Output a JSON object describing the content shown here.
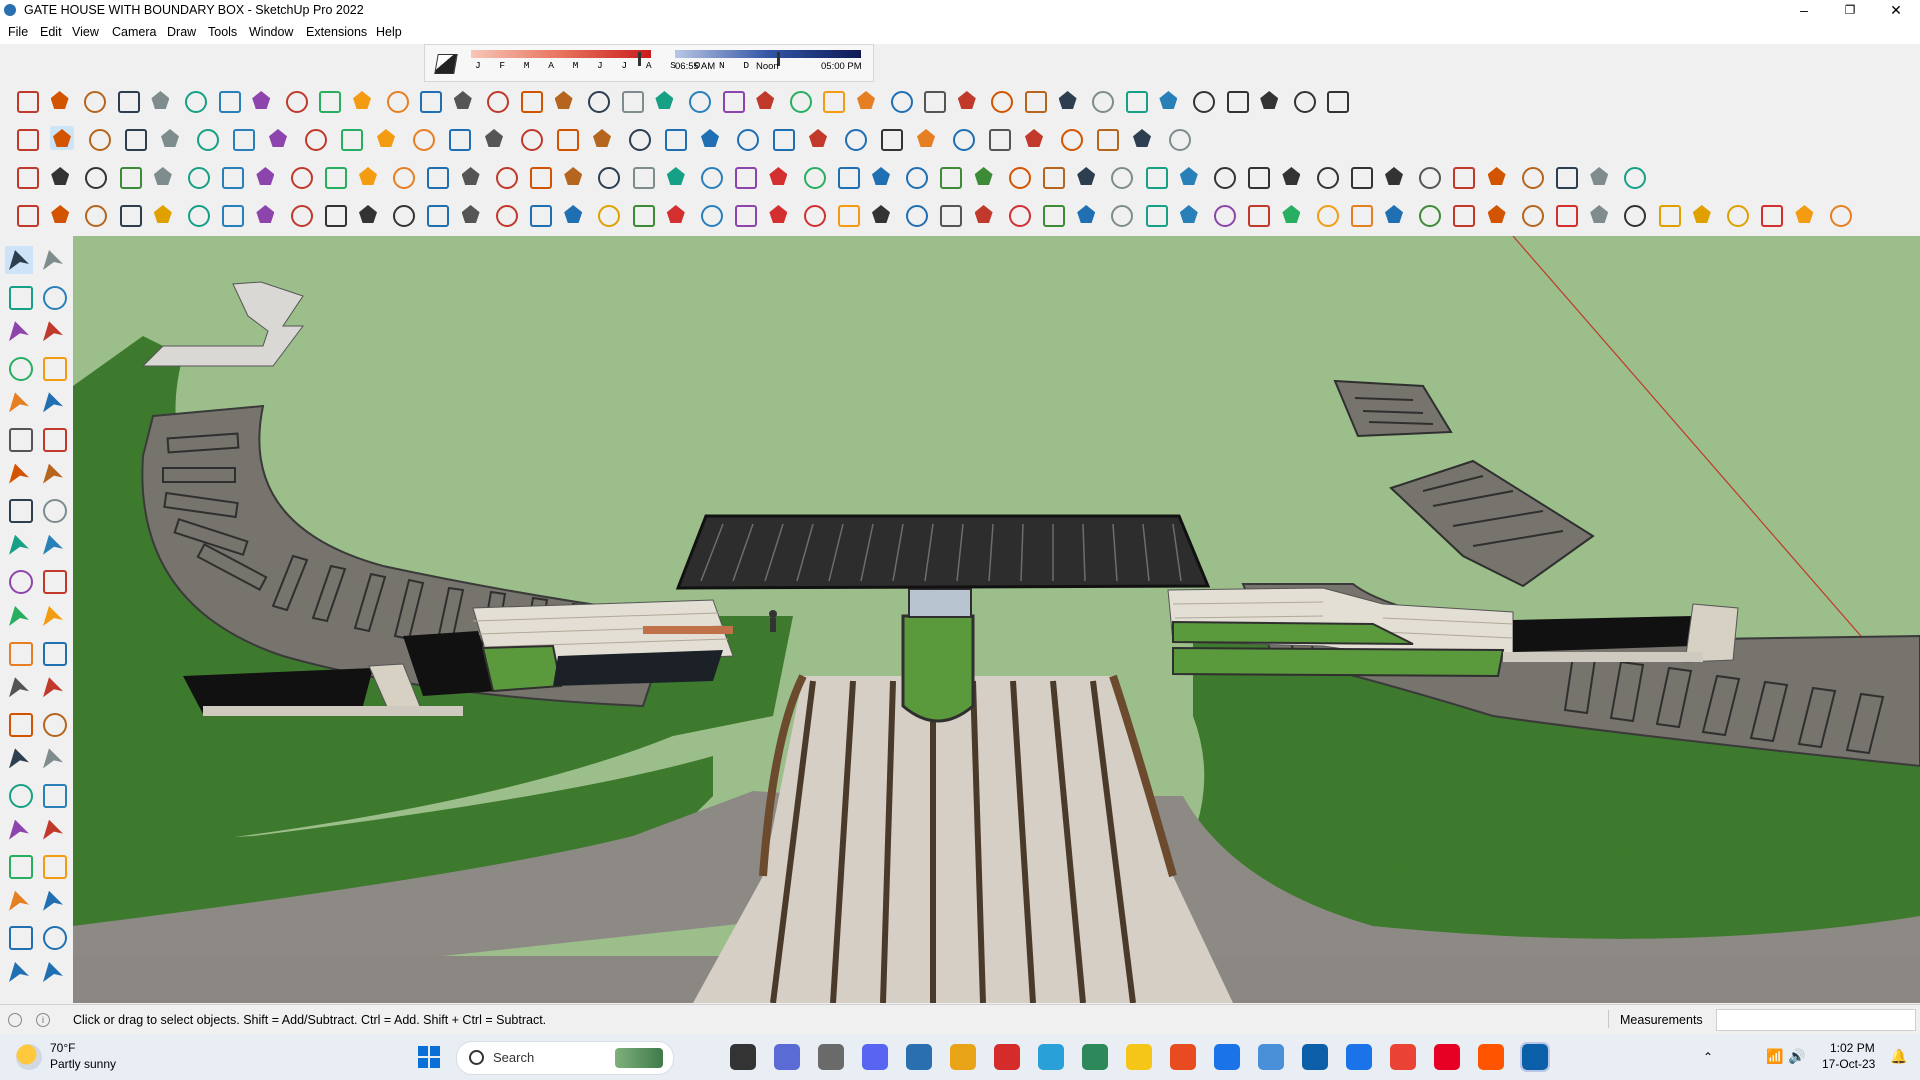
{
  "window": {
    "title": "GATE HOUSE WITH BOUNDARY BOX - SketchUp Pro 2022",
    "controls": {
      "minimize": "–",
      "maximize": "❐",
      "close": "✕"
    }
  },
  "menu": [
    "File",
    "Edit",
    "View",
    "Camera",
    "Draw",
    "Tools",
    "Window",
    "Extensions",
    "Help"
  ],
  "shadows": {
    "months": "J F M A M J J A S O N D",
    "time_start": "06:55 AM",
    "time_mid": "Noon",
    "time_end": "05:00 PM",
    "month_position": 0.93,
    "time_position": 0.55
  },
  "toolbars": {
    "row1": [
      "freehand-icon",
      "arc-curve-icon",
      "eraser-line-icon",
      "cut-icon",
      "rotate-icon",
      "move-icon",
      "follow-me-icon",
      "path-icon",
      "sphere-icon",
      "sweep-icon",
      "line-icon",
      "bevel-icon",
      "line-icon",
      "arc-icon",
      "frame-icon",
      "plane-icon",
      "stair-icon",
      "stair-icon",
      "grid-icon",
      "arc-icon",
      "window-icon",
      "door-icon",
      "roof-icon",
      "roof-icon",
      "wall-icon",
      "column-icon",
      "column-icon",
      "fence-icon",
      "facade-icon",
      "facade-icon",
      "pattern-icon",
      "pattern-icon",
      "pattern-icon",
      "pattern-icon",
      "pattern-icon",
      "house-icon",
      "house-icon",
      "house-icon",
      "house-icon",
      "house-icon"
    ],
    "row2": [
      "zoom-icon",
      "select-icon",
      "eraser-icon",
      "pencil-icon",
      "lasso-icon",
      "material-icon",
      "push-pull-icon",
      "follow-icon",
      "move-icon",
      "rotate-icon",
      "scale-icon",
      "tape-icon",
      "text-icon",
      "paint-icon",
      "orbit-icon",
      "pan-icon",
      "zoom-icon",
      "zoom-extents-icon",
      "layers-icon",
      "layers-icon",
      "layers-icon",
      "layers-icon",
      "component-icon",
      "section-icon",
      "sandbox-icon",
      "axis-icon",
      "axis-icon",
      "axis-icon",
      "axis-icon",
      "axis-icon",
      "axis-icon",
      "axis-icon",
      "magic-icon"
    ],
    "row3": [
      "camera-icon",
      "box-icon",
      "box-icon",
      "grass-icon",
      "shadow-icon",
      "grid-icon",
      "edit-icon",
      "array-icon",
      "array-icon",
      "array-icon",
      "balloon-icon",
      "ruler-icon",
      "shape-icon",
      "shape-icon",
      "shape-icon",
      "shape-icon",
      "shape-icon",
      "shape-icon",
      "shape-icon",
      "shape-icon",
      "shape-icon",
      "shape-icon",
      "line-red-icon",
      "eraser-pink-icon",
      "section-blue-icon",
      "section-blue-icon",
      "section-blue-icon",
      "terrain-icon",
      "terrain-icon",
      "globe-icon",
      "globe-icon",
      "globe-icon",
      "globe-icon",
      "globe-icon",
      "refresh-icon",
      "panel-icon",
      "panel-icon",
      "panel-icon",
      "panel-icon",
      "panel-icon",
      "panel-icon",
      "material-icon",
      "material-icon",
      "material-icon",
      "material-icon",
      "material-icon",
      "material-icon",
      "material-icon"
    ],
    "row4": [
      "component-icon",
      "curve-icon",
      "circle-icon",
      "ruler-icon",
      "sun-icon",
      "circle-icon",
      "sphere-icon",
      "group-icon",
      "group-icon",
      "box-wire-icon",
      "box-wire-icon",
      "box-wire-icon",
      "sphere-icon",
      "sphere-icon",
      "hand-icon",
      "cube-blue-icon",
      "cube-blue-icon",
      "cube-yellow-icon",
      "cube-green-icon",
      "cube-red-icon",
      "cube-grey-icon",
      "loop-icon",
      "red-square-icon",
      "grid-red-icon",
      "doc-icon",
      "box-brown-icon",
      "chain-icon",
      "curve-icon",
      "spline-icon",
      "move-red-icon",
      "move-green-icon",
      "move-blue-icon",
      "cone-icon",
      "cone-icon",
      "cone-icon",
      "hook-icon",
      "hook-icon",
      "spiral-icon",
      "star-icon",
      "cylinder-icon",
      "magnet-icon",
      "tree-icon",
      "axis-icon",
      "cube-multi-icon",
      "cube-multi-icon",
      "sphere-red-icon",
      "grid-multi-icon",
      "panel-icon",
      "grid-yellow-icon",
      "grid-yellow-icon",
      "grid-yellow-icon",
      "x-red-icon",
      "curve-icon",
      "grid-multi-icon"
    ]
  },
  "left_tools": [
    "select-icon",
    "orbit-icon",
    "paint-bucket-icon",
    "eraser-icon",
    "component-icon",
    "pencil-icon",
    "line-icon",
    "freehand-icon",
    "rectangle-icon",
    "rotated-rect-icon",
    "circle-icon",
    "polygon-icon",
    "arc-icon",
    "arc2-icon",
    "pie-icon",
    "arc3-icon",
    "move-icon",
    "push-pull-icon",
    "rotate-icon",
    "follow-me-icon",
    "scale-icon",
    "offset-icon",
    "tape-icon",
    "dimension-icon",
    "protractor-icon",
    "text-icon",
    "axes-icon",
    "3d-text-icon",
    "orbit-icon",
    "pan-icon",
    "zoom-icon",
    "zoom-window-icon",
    "zoom-extents-icon",
    "previous-icon",
    "walk-icon",
    "look-around-icon",
    "footprints-icon",
    "position-camera-icon",
    "section-plane-icon",
    "section-display-icon",
    "layers-icon",
    "layers2-icon"
  ],
  "status": {
    "hint": "Click or drag to select objects. Shift = Add/Subtract. Ctrl = Add. Shift + Ctrl = Subtract.",
    "measurements_label": "Measurements",
    "measurements_value": ""
  },
  "taskbar": {
    "weather_temp": "70°F",
    "weather_desc": "Partly sunny",
    "search_placeholder": "Search",
    "time": "1:02 PM",
    "date": "17-Oct-23",
    "apps": [
      "start-icon",
      "search-icon",
      "files-icon",
      "task-view-icon",
      "teams-icon",
      "calculator-icon",
      "folder-icon",
      "opera-icon",
      "telegram-icon",
      "photo-icon",
      "sticky-notes-icon",
      "brave-icon",
      "vscode-icon",
      "sketchup-layout-icon",
      "photoshop-icon",
      "drive-icon",
      "chrome-icon",
      "pinterest-icon",
      "soundcloud-icon",
      "photoshop-icon",
      "sketchup-icon"
    ]
  },
  "colors": {
    "grass": "#9cbe8a",
    "lawn": "#3e7a2d",
    "paving": "#8d8a86",
    "accent": "#005fb8"
  }
}
